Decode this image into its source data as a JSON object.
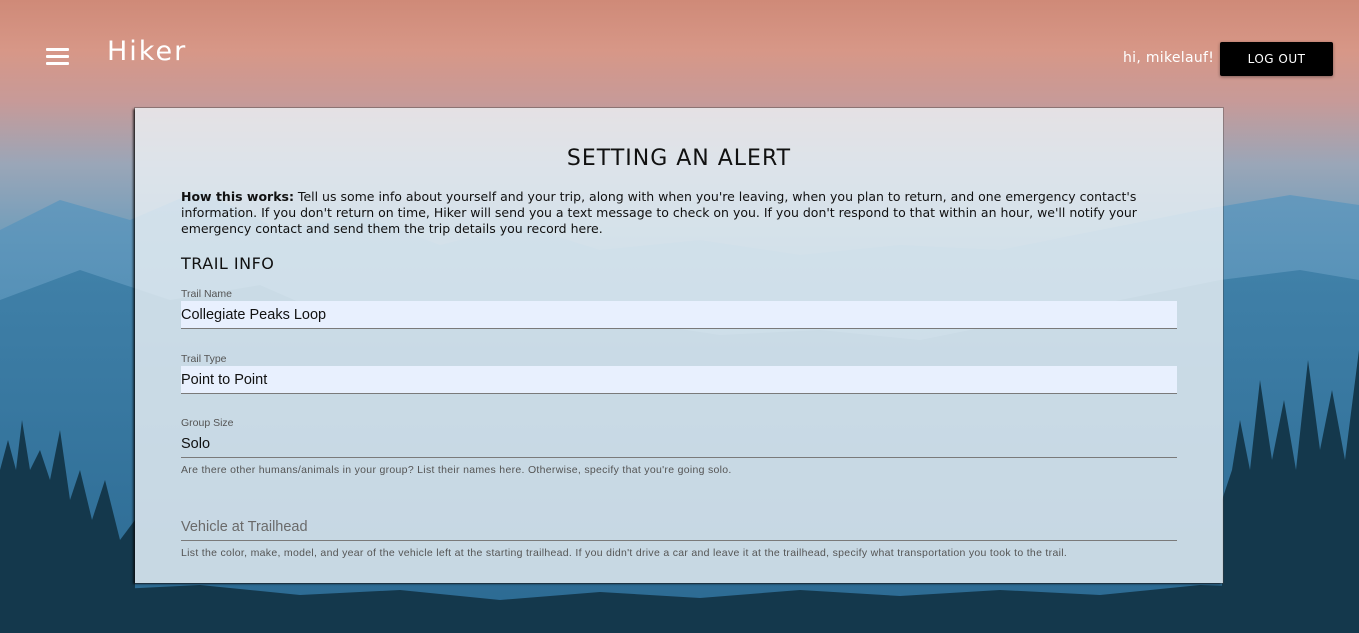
{
  "header": {
    "brand": "Hiker",
    "greeting": "hi, mikelauf!",
    "logout_label": "LOG OUT"
  },
  "card": {
    "title": "SETTING AN ALERT",
    "intro_bold": "How this works:",
    "intro_text": " Tell us some info about yourself and your trip, along with when you're leaving, when you plan to return, and one emergency contact's information. If you don't return on time, Hiker will send you a text message to check on you. If you don't respond to that within an hour, we'll notify your emergency contact and send them the trip details you record here.",
    "section_title": "TRAIL INFO",
    "fields": {
      "trail_name": {
        "label": "Trail Name",
        "value": "Collegiate Peaks Loop"
      },
      "trail_type": {
        "label": "Trail Type",
        "value": "Point to Point"
      },
      "group_size": {
        "label": "Group Size",
        "value": "Solo",
        "helper": "Are there other humans/animals in your group? List their names here. Otherwise, specify that you're going solo."
      },
      "vehicle": {
        "placeholder": "Vehicle at Trailhead",
        "helper": "List the color, make, model, and year of the vehicle left at the starting trailhead. If you didn't drive a car and leave it at the trailhead, specify what transportation you took to the trail."
      }
    }
  },
  "colors": {
    "sky_top": "#cf8a78",
    "mountain_blue": "#3f86ad",
    "forest": "#173f55",
    "button_bg": "#000000",
    "autofill_bg": "#e8f0fe"
  }
}
